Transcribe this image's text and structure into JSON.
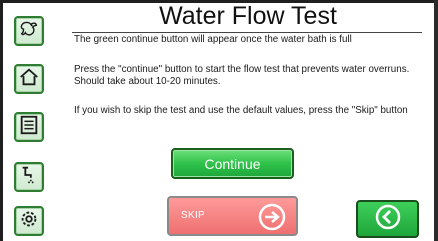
{
  "header": {
    "title": "Water Flow Test"
  },
  "messages": {
    "line1": "The green continue button will appear once the water bath is full",
    "line2": "Press the \"continue\" button to start the flow test that prevents water overruns. Should take about 10-20 minutes.",
    "line3": "If you wish to skip the test and use the default values, press the \"Skip\" button"
  },
  "buttons": {
    "continue_label": "Continue",
    "skip_label": "SKIP"
  },
  "sidebar": {
    "items": [
      {
        "icon": "dragon-icon"
      },
      {
        "icon": "home-icon"
      },
      {
        "icon": "list-icon"
      },
      {
        "icon": "faucet-icon"
      },
      {
        "icon": "gear-icon"
      }
    ]
  },
  "colors": {
    "accent_green": "#2fc24a",
    "skip_red": "#ef7070",
    "border_green": "#2e7d32"
  }
}
